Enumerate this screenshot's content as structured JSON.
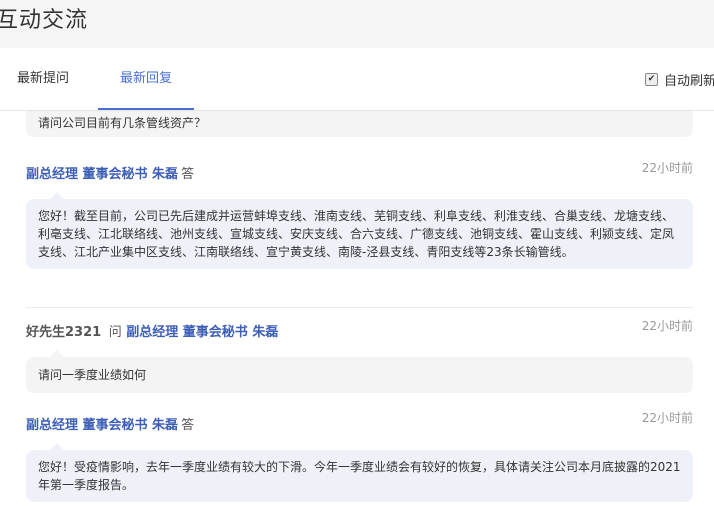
{
  "header": {
    "title": "互动交流"
  },
  "tabs": [
    {
      "label": "最新提问"
    },
    {
      "label": "最新回复"
    }
  ],
  "autorefresh": {
    "label": "自动刷新",
    "checked": true
  },
  "feed": [
    {
      "question_text": "请问公司目前有几条管线资产？",
      "answerer_role": "副总经理 董事会秘书 朱磊",
      "answer_verb": "答",
      "answer_time": "22小时前",
      "answer_text": "您好！截至目前，公司已先后建成并运营蚌埠支线、淮南支线、芜铜支线、利阜支线、利淮支线、合巢支线、龙塘支线、利亳支线、江北联络线、池州支线、宣城支线、安庆支线、合六支线、广德支线、池铜支线、霍山支线、利颍支线、定凤支线、江北产业集中区支线、江南联络线、宣宁黄支线、南陵-泾县支线、青阳支线等23条长输管线。"
    },
    {
      "asker": "好先生2321",
      "ask_verb": "问",
      "to_role": "副总经理 董事会秘书 朱磊",
      "question_time": "22小时前",
      "question_text": "请问一季度业绩如何",
      "answerer_role": "副总经理 董事会秘书 朱磊",
      "answer_verb": "答",
      "answer_time": "22小时前",
      "answer_text": "您好！受疫情影响，去年一季度业绩有较大的下滑。今年一季度业绩会有较好的恢复，具体请关注公司本月底披露的2021年第一季度报告。"
    }
  ]
}
